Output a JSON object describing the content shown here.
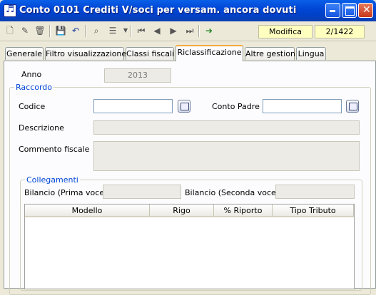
{
  "window": {
    "title": "Conto 0101 Crediti V/soci per versam. ancora dovuti"
  },
  "toolbar": {
    "mode": "Modifica",
    "record": "2/1422"
  },
  "tabs": [
    "Generale",
    "Filtro visualizzazione",
    "Classi fiscali",
    "Riclassificazione",
    "Altre gestioni",
    "Lingua"
  ],
  "form": {
    "anno_label": "Anno",
    "anno_value": "2013",
    "raccordo_title": "Raccordo",
    "codice_label": "Codice",
    "conto_padre_label": "Conto Padre",
    "descrizione_label": "Descrizione",
    "commento_label": "Commento fiscale",
    "collegamenti_title": "Collegamenti",
    "bil_prima_label": "Bilancio (Prima voce)",
    "bil_seconda_label": "Bilancio (Seconda voce)"
  },
  "grid": {
    "columns": [
      "Modello",
      "Rigo",
      "% Riporto",
      "Tipo Tributo"
    ]
  },
  "colors": {
    "title_bar": "#0047d6",
    "tab_active_accent": "#f6a83c",
    "group_title": "#0046d5",
    "status_bg": "#ffffc0"
  }
}
